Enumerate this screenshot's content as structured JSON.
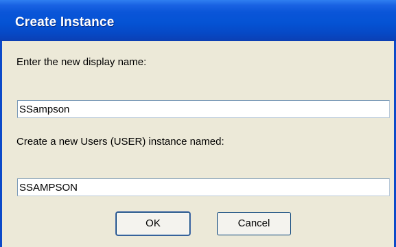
{
  "window": {
    "title": "Create Instance"
  },
  "form": {
    "display_name_label": "Enter the new display name:",
    "display_name_value": "SSampson",
    "instance_label": "Create a new Users (USER) instance named:",
    "instance_value": "SSAMPSON"
  },
  "buttons": {
    "ok_label": "OK",
    "cancel_label": "Cancel"
  },
  "colors": {
    "titlebar": "#0553d4",
    "dialog_background": "#ece9d8",
    "border_accent": "#0c4ac9"
  }
}
